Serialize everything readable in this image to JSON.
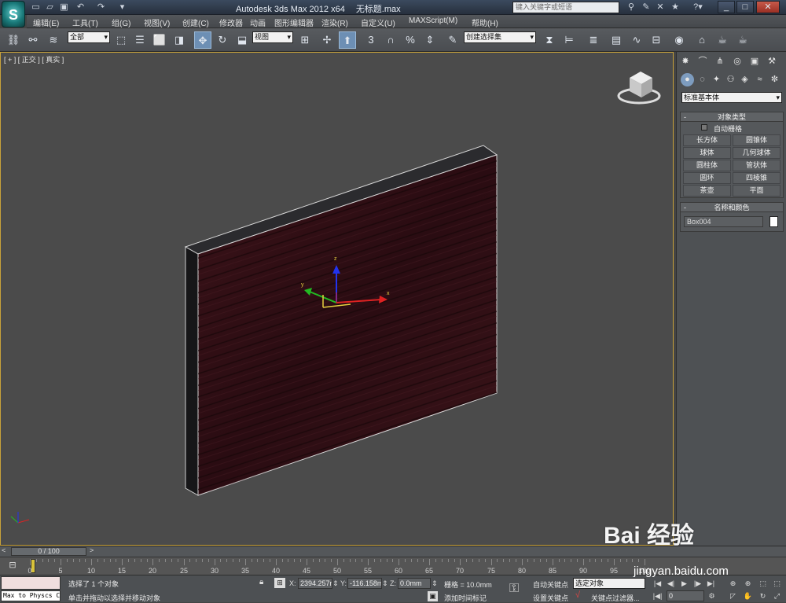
{
  "titlebar": {
    "app_title": "Autodesk 3ds Max  2012 x64",
    "file_name": "无标题.max",
    "search_placeholder": "键入关键字或短语",
    "quick_access_icons": [
      "new-file-icon",
      "open-file-icon",
      "save-icon",
      "undo-icon",
      "redo-icon",
      "dropdown-icon"
    ],
    "window_controls": [
      "minimize",
      "maximize",
      "close"
    ]
  },
  "menu": [
    "编辑(E)",
    "工具(T)",
    "组(G)",
    "视图(V)",
    "创建(C)",
    "修改器",
    "动画",
    "图形编辑器",
    "渲染(R)",
    "自定义(U)",
    "MAXScript(M)",
    "帮助(H)"
  ],
  "toolbar": {
    "selection_filter": "全部",
    "ref_coord": "视图",
    "named_selection": "创建选择集",
    "snap_label": "3",
    "percent_label": "%"
  },
  "viewport": {
    "label": "[ + ] [ 正交 ] [ 真实 ]",
    "gizmo_x": "x",
    "gizmo_y": "y",
    "gizmo_z": "z"
  },
  "command_panel": {
    "category": "标准基本体",
    "object_type_title": "对象类型",
    "auto_grid": "自动栅格",
    "buttons": [
      "长方体",
      "圆锥体",
      "球体",
      "几何球体",
      "圆柱体",
      "管状体",
      "圆环",
      "四棱锥",
      "茶壶",
      "平面"
    ],
    "name_color_title": "名称和颜色",
    "object_name": "Box004",
    "object_color": "#ffffff"
  },
  "timeline": {
    "slider_label": "0 / 100",
    "ticks": [
      0,
      5,
      10,
      15,
      20,
      25,
      30,
      35,
      40,
      45,
      50,
      55,
      60,
      65,
      70,
      75,
      80,
      85,
      90,
      95,
      100
    ]
  },
  "status": {
    "listener_text": "Max to Physcs C",
    "selected": "选择了 1 个对象",
    "prompt": "单击并拖动以选择并移动对象",
    "x_label": "X:",
    "x_value": "2394.257m",
    "y_label": "Y:",
    "y_value": "-116.158m",
    "z_label": "Z:",
    "z_value": "0.0mm",
    "grid": "栅格 = 10.0mm",
    "add_time_tag": "添加时间标记",
    "auto_key": "自动关键点",
    "set_key_mode": "选定对象",
    "set_key": "设置关键点",
    "key_filters": "关键点过滤器...",
    "current_frame": "0"
  },
  "watermark": {
    "brand": "Bai 经验",
    "url": "jingyan.baidu.com"
  }
}
